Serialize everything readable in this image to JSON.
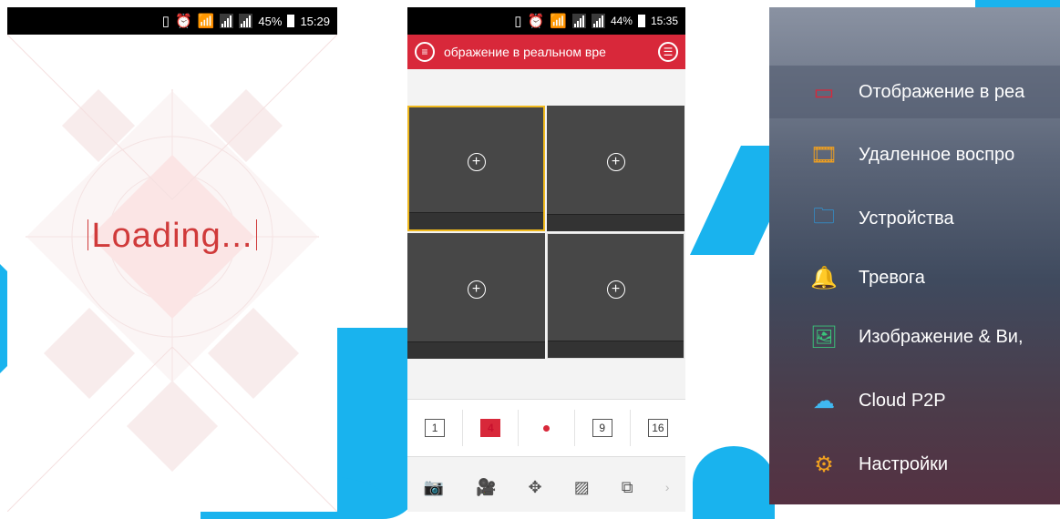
{
  "phone1": {
    "status": {
      "battery": "45%",
      "time": "15:29"
    },
    "loading_text": "Loading..."
  },
  "phone2": {
    "status": {
      "battery": "44%",
      "time": "15:35"
    },
    "title": "ображение в реальном вре",
    "layouts": [
      "1",
      "4",
      "9",
      "16"
    ],
    "selected_layout": "4",
    "toolbar_icons": [
      "camera-icon",
      "video-record-icon",
      "ptz-icon",
      "image-quality-icon",
      "close-window-icon",
      "chevron-right-icon"
    ]
  },
  "phone3": {
    "menu": [
      {
        "label": "Отображение в реа",
        "icon": "live-view-icon",
        "color": "#d8283a",
        "active": true
      },
      {
        "label": "Удаленное воспро",
        "icon": "playback-icon",
        "color": "#f0a020",
        "active": false
      },
      {
        "label": "Устройства",
        "icon": "devices-icon",
        "color": "#2aa0e8",
        "active": false
      },
      {
        "label": "Тревога",
        "icon": "bell-icon",
        "color": "#e04aa8",
        "active": false
      },
      {
        "label": "Изображение & Ви,",
        "icon": "image-icon",
        "color": "#3ac47a",
        "active": false
      },
      {
        "label": "Cloud P2P",
        "icon": "cloud-icon",
        "color": "#40b8f0",
        "active": false
      },
      {
        "label": "Настройки",
        "icon": "gear-icon",
        "color": "#f0a020",
        "active": false
      }
    ]
  }
}
